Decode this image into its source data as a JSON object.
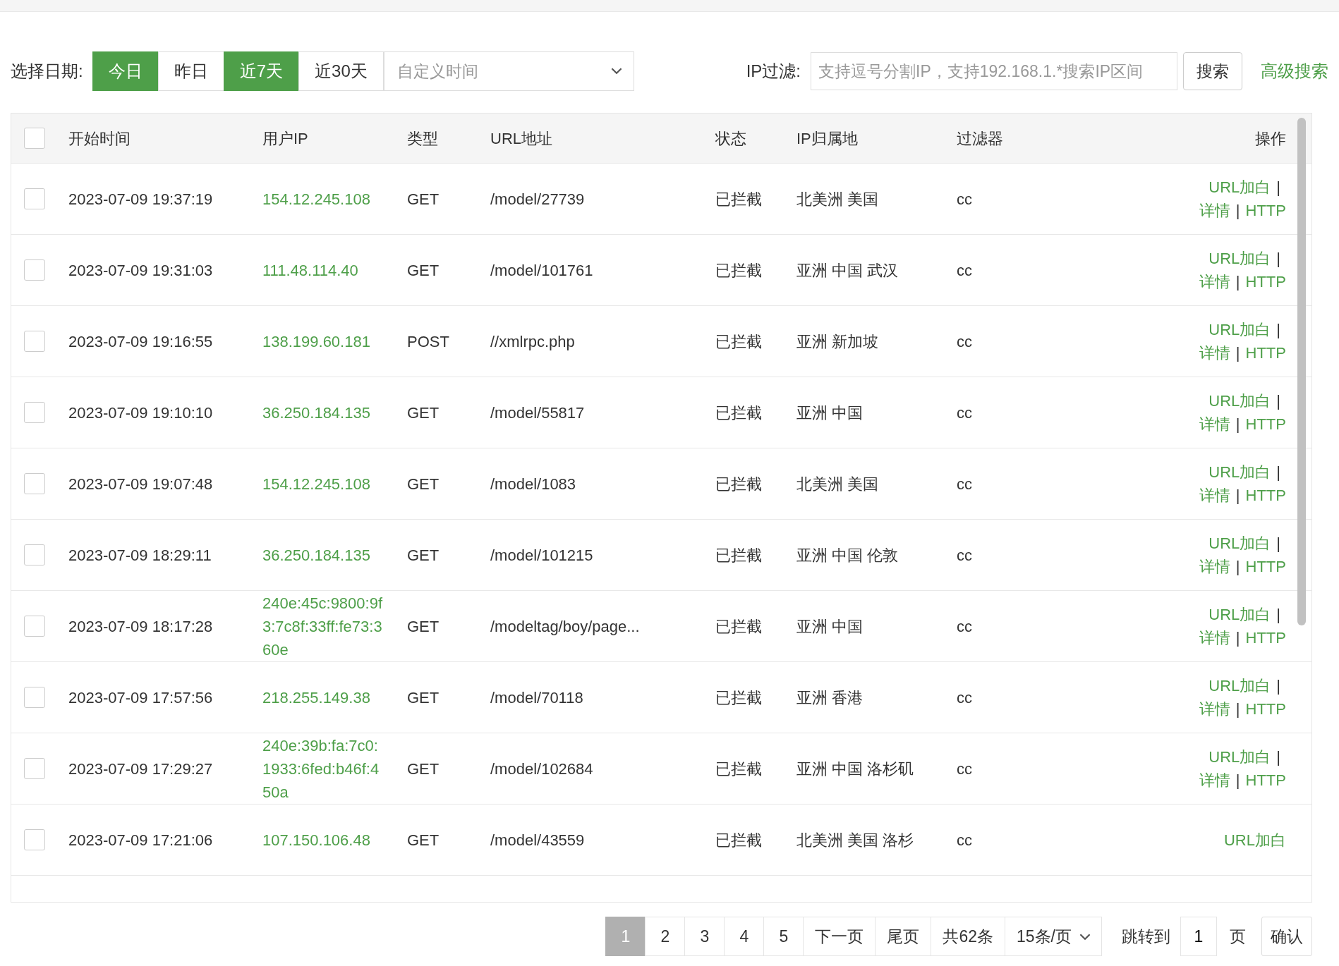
{
  "filter_bar": {
    "date_label": "选择日期:",
    "date_buttons": [
      {
        "label": "今日",
        "selected": true
      },
      {
        "label": "昨日",
        "selected": false
      },
      {
        "label": "近7天",
        "selected": true
      },
      {
        "label": "近30天",
        "selected": false
      }
    ],
    "custom_time": {
      "placeholder": "自定义时间"
    },
    "ip_label": "IP过滤:",
    "ip_field": {
      "placeholder": "支持逗号分割IP，支持192.168.1.*搜索IP区间"
    },
    "search_button": "搜索",
    "advanced_search": "高级搜索"
  },
  "table": {
    "columns": [
      "开始时间",
      "用户IP",
      "类型",
      "URL地址",
      "状态",
      "IP归属地",
      "过滤器",
      "操作"
    ],
    "header_checked": false,
    "action_separator": "|",
    "rows": [
      {
        "checked": false,
        "time": "2023-07-09 19:37:19",
        "ip": "154.12.245.108",
        "type": "GET",
        "url": "/model/27739",
        "status": "已拦截",
        "location": "北美洲 美国",
        "filter": "cc",
        "actions": [
          "URL加白",
          "详情",
          "HTTP"
        ]
      },
      {
        "checked": false,
        "time": "2023-07-09 19:31:03",
        "ip": "111.48.114.40",
        "type": "GET",
        "url": "/model/101761",
        "status": "已拦截",
        "location": "亚洲 中国 武汉",
        "filter": "cc",
        "actions": [
          "URL加白",
          "详情",
          "HTTP"
        ]
      },
      {
        "checked": false,
        "time": "2023-07-09 19:16:55",
        "ip": "138.199.60.181",
        "type": "POST",
        "url": "//xmlrpc.php",
        "status": "已拦截",
        "location": "亚洲 新加坡",
        "filter": "cc",
        "actions": [
          "URL加白",
          "详情",
          "HTTP"
        ]
      },
      {
        "checked": false,
        "time": "2023-07-09 19:10:10",
        "ip": "36.250.184.135",
        "type": "GET",
        "url": "/model/55817",
        "status": "已拦截",
        "location": "亚洲 中国",
        "filter": "cc",
        "actions": [
          "URL加白",
          "详情",
          "HTTP"
        ]
      },
      {
        "checked": false,
        "time": "2023-07-09 19:07:48",
        "ip": "154.12.245.108",
        "type": "GET",
        "url": "/model/1083",
        "status": "已拦截",
        "location": "北美洲 美国",
        "filter": "cc",
        "actions": [
          "URL加白",
          "详情",
          "HTTP"
        ]
      },
      {
        "checked": false,
        "time": "2023-07-09 18:29:11",
        "ip": "36.250.184.135",
        "type": "GET",
        "url": "/model/101215",
        "status": "已拦截",
        "location": "亚洲 中国 伦敦",
        "filter": "cc",
        "actions": [
          "URL加白",
          "详情",
          "HTTP"
        ]
      },
      {
        "checked": false,
        "time": "2023-07-09 18:17:28",
        "ip": "240e:45c:9800:9f3:7c8f:33ff:fe73:360e",
        "type": "GET",
        "url": "/modeltag/boy/page...",
        "status": "已拦截",
        "location": "亚洲 中国",
        "filter": "cc",
        "actions": [
          "URL加白",
          "详情",
          "HTTP"
        ]
      },
      {
        "checked": false,
        "time": "2023-07-09 17:57:56",
        "ip": "218.255.149.38",
        "type": "GET",
        "url": "/model/70118",
        "status": "已拦截",
        "location": "亚洲 香港",
        "filter": "cc",
        "actions": [
          "URL加白",
          "详情",
          "HTTP"
        ]
      },
      {
        "checked": false,
        "time": "2023-07-09 17:29:27",
        "ip": "240e:39b:fa:7c0:1933:6fed:b46f:450a",
        "type": "GET",
        "url": "/model/102684",
        "status": "已拦截",
        "location": "亚洲 中国 洛杉矶",
        "filter": "cc",
        "actions": [
          "URL加白",
          "详情",
          "HTTP"
        ]
      },
      {
        "checked": false,
        "time": "2023-07-09 17:21:06",
        "ip": "107.150.106.48",
        "type": "GET",
        "url": "/model/43559",
        "status": "已拦截",
        "location": "北美洲 美国 洛杉",
        "filter": "cc",
        "actions": [
          "URL加白"
        ]
      }
    ]
  },
  "pagination": {
    "pages": [
      {
        "label": "1",
        "selected": true
      },
      {
        "label": "2",
        "selected": false
      },
      {
        "label": "3",
        "selected": false
      },
      {
        "label": "4",
        "selected": false
      },
      {
        "label": "5",
        "selected": false
      }
    ],
    "next": "下一页",
    "last": "尾页",
    "total": "共62条",
    "page_size": "15条/页",
    "jump_label": "跳转到",
    "jump_value": "1",
    "page_unit": "页",
    "confirm": "确认"
  }
}
